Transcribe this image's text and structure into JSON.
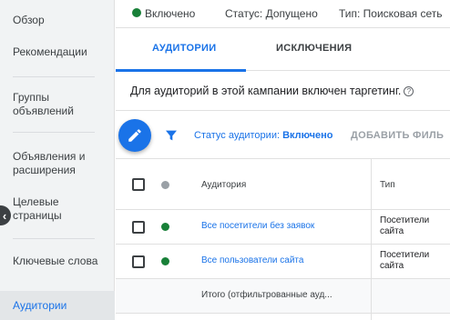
{
  "sidebar": {
    "items": [
      {
        "label": "Обзор"
      },
      {
        "label": "Рекомендации"
      },
      {
        "label": "Группы объявлений"
      },
      {
        "label": "Объявления и расширения"
      },
      {
        "label": "Целевые страницы"
      },
      {
        "label": "Ключевые слова"
      }
    ],
    "active": "Аудитории",
    "collapse_glyph": "‹"
  },
  "status_bar": {
    "enabled": "Включено",
    "status": "Статус: Допущено",
    "type": "Тип: Поисковая сеть"
  },
  "tabs": [
    {
      "label": "АУДИТОРИИ",
      "active": true
    },
    {
      "label": "ИСКЛЮЧЕНИЯ",
      "active": false
    }
  ],
  "info_text": "Для аудиторий в этой кампании включен таргетинг.",
  "help_glyph": "?",
  "toolbar": {
    "filter_label": "Статус аудитории:",
    "filter_value": "Включено",
    "add_filter": "ДОБАВИТЬ ФИЛЬ"
  },
  "table": {
    "headers": {
      "audience": "Аудитория",
      "type": "Тип"
    },
    "rows": [
      {
        "name": "Все посетители без заявок",
        "type": "Посетители сайта"
      },
      {
        "name": "Все пользователи сайта",
        "type": "Посетители сайта"
      }
    ],
    "total": "Итого (отфильтрованные ауд..."
  },
  "colors": {
    "accent": "#1a73e8",
    "enabled_green": "#188038"
  },
  "icons": [
    "pencil-icon",
    "filter-icon",
    "help-icon",
    "chevron-left-icon"
  ]
}
